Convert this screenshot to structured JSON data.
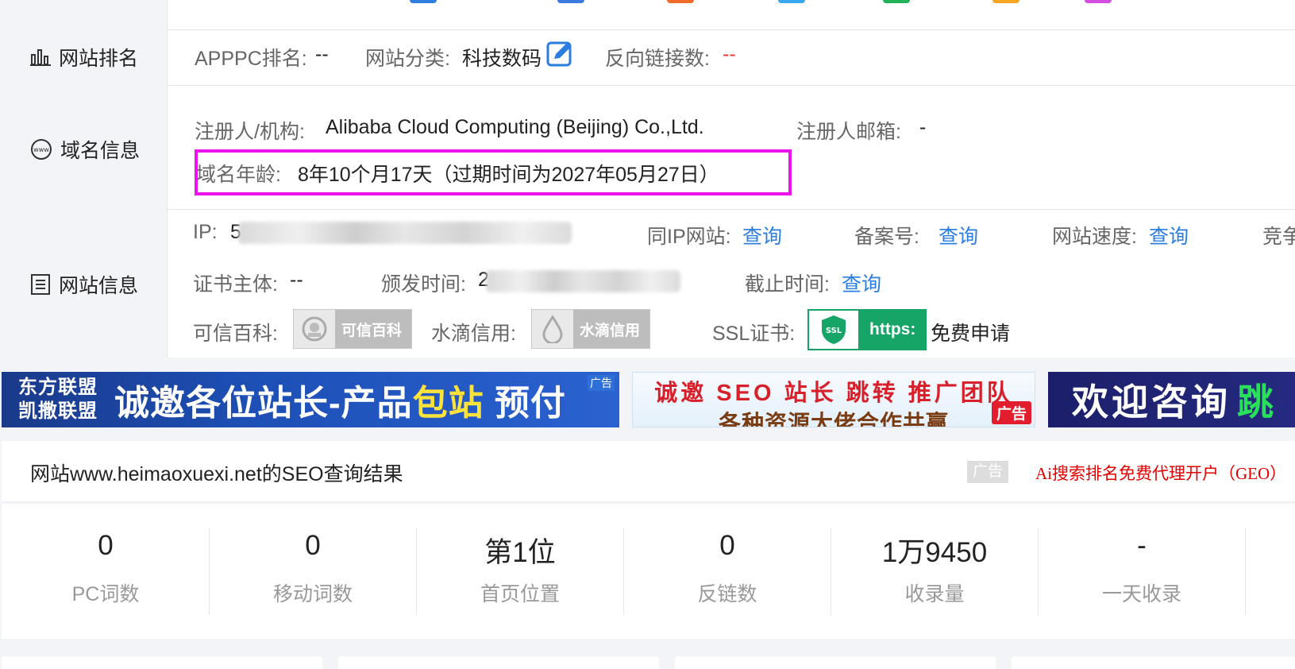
{
  "sidebar": {
    "ranking": "网站排名",
    "domain_info": "域名信息",
    "site_info": "网站信息"
  },
  "ranking_row": {
    "appc_label": "APPPC排名:",
    "appc_value": "--",
    "category_label": "网站分类:",
    "category_value": "科技数码",
    "backlinks_label": "反向链接数:",
    "backlinks_value": "--"
  },
  "domain_row": {
    "registrant_label": "注册人/机构:",
    "registrant_value": "Alibaba Cloud Computing (Beijing) Co.,Ltd.",
    "email_label": "注册人邮箱:",
    "email_value": "-",
    "age_label": "域名年龄:",
    "age_value": "8年10个月17天（过期时间为2027年05月27日）"
  },
  "site_row": {
    "ip_label": "IP:",
    "ip_value_prefix": "5",
    "same_ip_label": "同IP网站:",
    "same_ip_link": "查询",
    "icp_label": "备案号:",
    "icp_link": "查询",
    "speed_label": "网站速度:",
    "speed_link": "查询",
    "compete_label": "竞争",
    "cert_subject_label": "证书主体:",
    "cert_subject_value": "--",
    "issue_label": "颁发时间:",
    "issue_value_prefix": "2",
    "expire_label": "截止时间:",
    "expire_link": "查询",
    "kexin_label": "可信百科:",
    "kexin_badge": "可信百科",
    "shuidi_label": "水滴信用:",
    "shuidi_badge": "水滴信用",
    "ssl_label": "SSL证书:",
    "ssl_badge_icon_text": "SSL",
    "ssl_badge": "https:",
    "ssl_free": "免费申请"
  },
  "banners": {
    "b1_left_top": "东方联盟",
    "b1_left_bottom": "凯撒联盟",
    "b1_main": "诚邀各位站长-产品",
    "b1_yellow": "包站",
    "b1_end": "预付",
    "b1_ad": "广告",
    "b2_line1": "诚邀 SEO 站长 跳转 推广团队",
    "b2_line2": "各种资源大佬合作共赢",
    "b2_ad": "广告",
    "b3_text": "欢迎咨询",
    "b3_green": "跳"
  },
  "results": {
    "title": "网站www.heimaoxuexi.net的SEO查询结果",
    "ad_tag": "广告",
    "ad_link": "Ai搜索排名免费代理开户（GEO）"
  },
  "stats": [
    {
      "value": "0",
      "caption": "PC词数"
    },
    {
      "value": "0",
      "caption": "移动词数"
    },
    {
      "value": "第1位",
      "caption": "首页位置"
    },
    {
      "value": "0",
      "caption": "反链数"
    },
    {
      "value": "1万9450",
      "caption": "收录量"
    },
    {
      "value": "-",
      "caption": "一天收录"
    }
  ],
  "colors": {
    "highlight": "#ec14ec",
    "link": "#2b7de0",
    "ssl_green": "#16a567",
    "red": "#e33333"
  }
}
